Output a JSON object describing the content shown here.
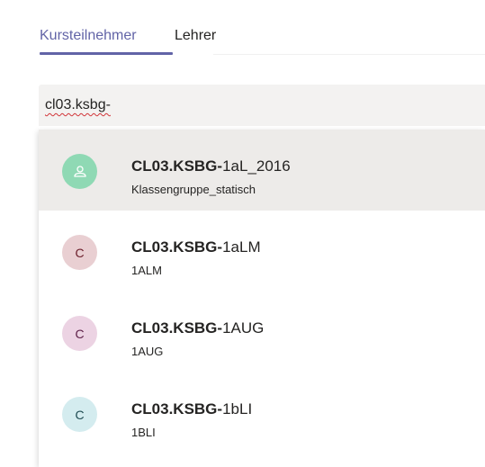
{
  "tabs": [
    {
      "label": "Kursteilnehmer",
      "active": true
    },
    {
      "label": "Lehrer",
      "active": false
    }
  ],
  "colors": {
    "accent": "#6264a7",
    "highlight": "#edebe9",
    "search_bg": "#f3f2f1",
    "spellcheck": "#d13438"
  },
  "search": {
    "value": "cl03.ksbg-"
  },
  "results": [
    {
      "prefix": "CL03.KSBG-",
      "suffix": "1aL_2016",
      "subtitle": "Klassengruppe_statisch",
      "avatar_text": "",
      "avatar_icon": "group-icon",
      "avatar_bg": "#8fd9b4",
      "avatar_fg": "#ffffff",
      "highlighted": true
    },
    {
      "prefix": "CL03.KSBG-",
      "suffix": "1aLM",
      "subtitle": "1ALM",
      "avatar_text": "C",
      "avatar_bg": "#e9cfd2",
      "avatar_fg": "#6b1d2a",
      "highlighted": false
    },
    {
      "prefix": "CL03.KSBG-",
      "suffix": "1AUG",
      "subtitle": "1AUG",
      "avatar_text": "C",
      "avatar_bg": "#ecd3e3",
      "avatar_fg": "#5c1f47",
      "highlighted": false
    },
    {
      "prefix": "CL03.KSBG-",
      "suffix": "1bLI",
      "subtitle": "1BLI",
      "avatar_text": "C",
      "avatar_bg": "#d4ecef",
      "avatar_fg": "#1f4b52",
      "highlighted": false
    }
  ]
}
